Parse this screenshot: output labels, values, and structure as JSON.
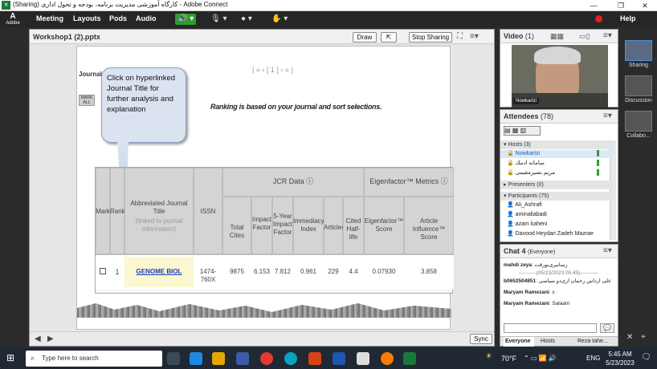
{
  "window": {
    "title": "(Sharing) کارگاه آموزشی مدیریت برنامه، بودجه و تحول اداری - Adobe Connect",
    "min": "—",
    "restore": "❐",
    "close": "✕"
  },
  "menubar": {
    "logo_label": "Adobe",
    "items": [
      "Meeting",
      "Layouts",
      "Pods",
      "Audio"
    ],
    "help": "Help"
  },
  "share_pod": {
    "title": "Workshop1 (2).pptx",
    "draw_label": "Draw",
    "stop_label": "Stop Sharing",
    "sync_label": "Sync",
    "slide": {
      "journals_label": "Journals 1",
      "mark_all": "MARK ALL",
      "pager": "| « ‹ [ 1 ] › » |",
      "callout": "Click on hyperlinked Journal Title for further analysis and explanation",
      "ranking_note": "Ranking is based on your journal and sort selections.",
      "group_jcr": "JCR Data ⓘ",
      "group_eigen": "Eigenfactor™ Metrics ⓘ",
      "headers": [
        "Mark",
        "Rank",
        "Abbreviated Journal Title",
        "(linked to journal information)",
        "ISSN",
        "Total Cites",
        "Impact Factor",
        "5-Year Impact Factor",
        "Immediacy Index",
        "Articles",
        "Cited Half-life",
        "Eigenfactor™ Score",
        "Article Influence™ Score"
      ],
      "row": {
        "rank": "1",
        "title": "GENOME BIOL",
        "issn": "1474-760X",
        "total_cites": "9875",
        "impact_factor": "6.153",
        "five_year": "7.812",
        "immediacy": "0.961",
        "articles": "229",
        "half_life": "4.4",
        "eigenfactor": "0.07930",
        "article_influence": "3.858"
      }
    }
  },
  "video_pod": {
    "title": "Video",
    "count": "(1)",
    "name_tag": "Nowkarizi"
  },
  "attendees_pod": {
    "title": "Attendees",
    "count": "(78)",
    "hosts_label": "Hosts (3)",
    "hosts": [
      "Nowkarizi",
      "سامانه ادمك",
      "مریم نصیرمقیمی"
    ],
    "presenters_label": "Presenters (0)",
    "participants_label": "Participants (75)",
    "participants": [
      "Ali_Ashrafi",
      "aminaliabadi",
      "azam kaheni",
      "Davood Heydari Zadeh Mazrae"
    ]
  },
  "chat_pod": {
    "title": "Chat",
    "count": "4",
    "scope": "(Everyone)",
    "lines": [
      {
        "sender": "mahdi zeya",
        "text": "رسانیری‌بورقت"
      },
      {
        "sender": "",
        "text": "----------(05/23/2023 05:45)----------"
      },
      {
        "sender": "b0652504851",
        "text": ": علی ارداس رحمان آری‌دو سیاسی"
      },
      {
        "sender": "Maryam Ramezani",
        "text": "s"
      },
      {
        "sender": "Maryam Ramezani",
        "text": "Salaam"
      }
    ],
    "tabs": [
      "Everyone",
      "Hosts",
      "Reza tahe..."
    ]
  },
  "layouts": [
    "Sharing",
    "Discussion",
    "Collabo..."
  ],
  "taskbar": {
    "search_placeholder": "Type here to search",
    "weather": "70°F",
    "lang": "ENG",
    "time": "5:45 AM",
    "date": "5/23/2023"
  },
  "colors": {
    "accent_green": "#2e9d2e",
    "brand_dark": "#262626",
    "link_blue": "#1a3fbf"
  }
}
